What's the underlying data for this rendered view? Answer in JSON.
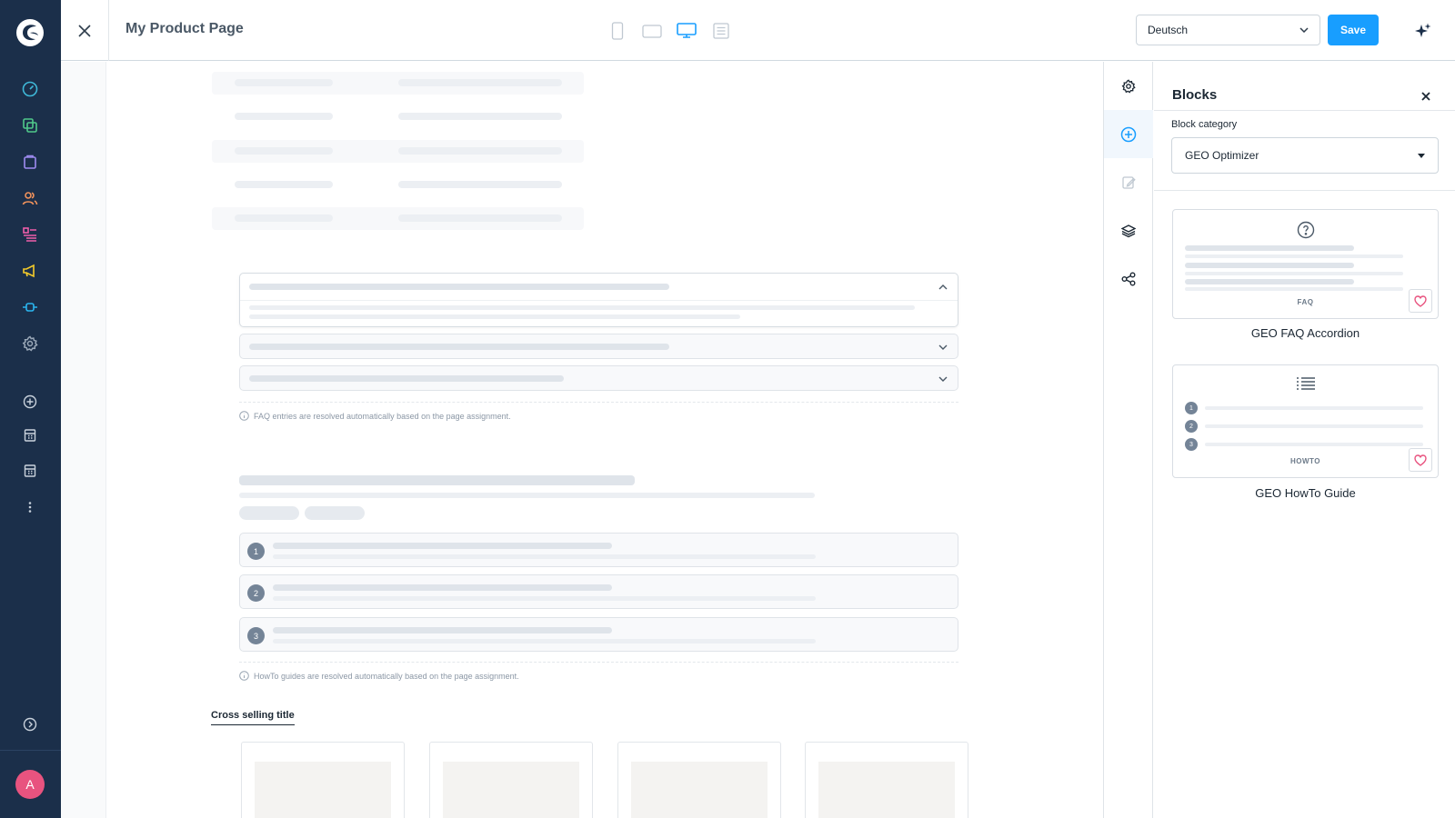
{
  "header": {
    "page_title": "My Product Page",
    "language": "Deutsch",
    "save_label": "Save"
  },
  "canvas": {
    "faq_note": "FAQ entries are resolved automatically based on the page assignment.",
    "howto_note": "HowTo guides are resolved automatically based on the page assignment.",
    "howto_steps": [
      "1",
      "2",
      "3"
    ],
    "cross_selling_title": "Cross selling title"
  },
  "panel": {
    "title": "Blocks",
    "category_label": "Block category",
    "category_value": "GEO Optimizer",
    "blocks": [
      {
        "tag": "FAQ",
        "name": "GEO FAQ Accordion"
      },
      {
        "tag": "HOWTO",
        "name": "GEO HowTo Guide",
        "steps": [
          "1",
          "2",
          "3"
        ]
      }
    ]
  },
  "user": {
    "avatar_initial": "A"
  },
  "colors": {
    "sidebar_bg": "#1b2f4a",
    "accent": "#189eff",
    "avatar": "#e8537f",
    "favorite_heart": "#e8537f"
  }
}
